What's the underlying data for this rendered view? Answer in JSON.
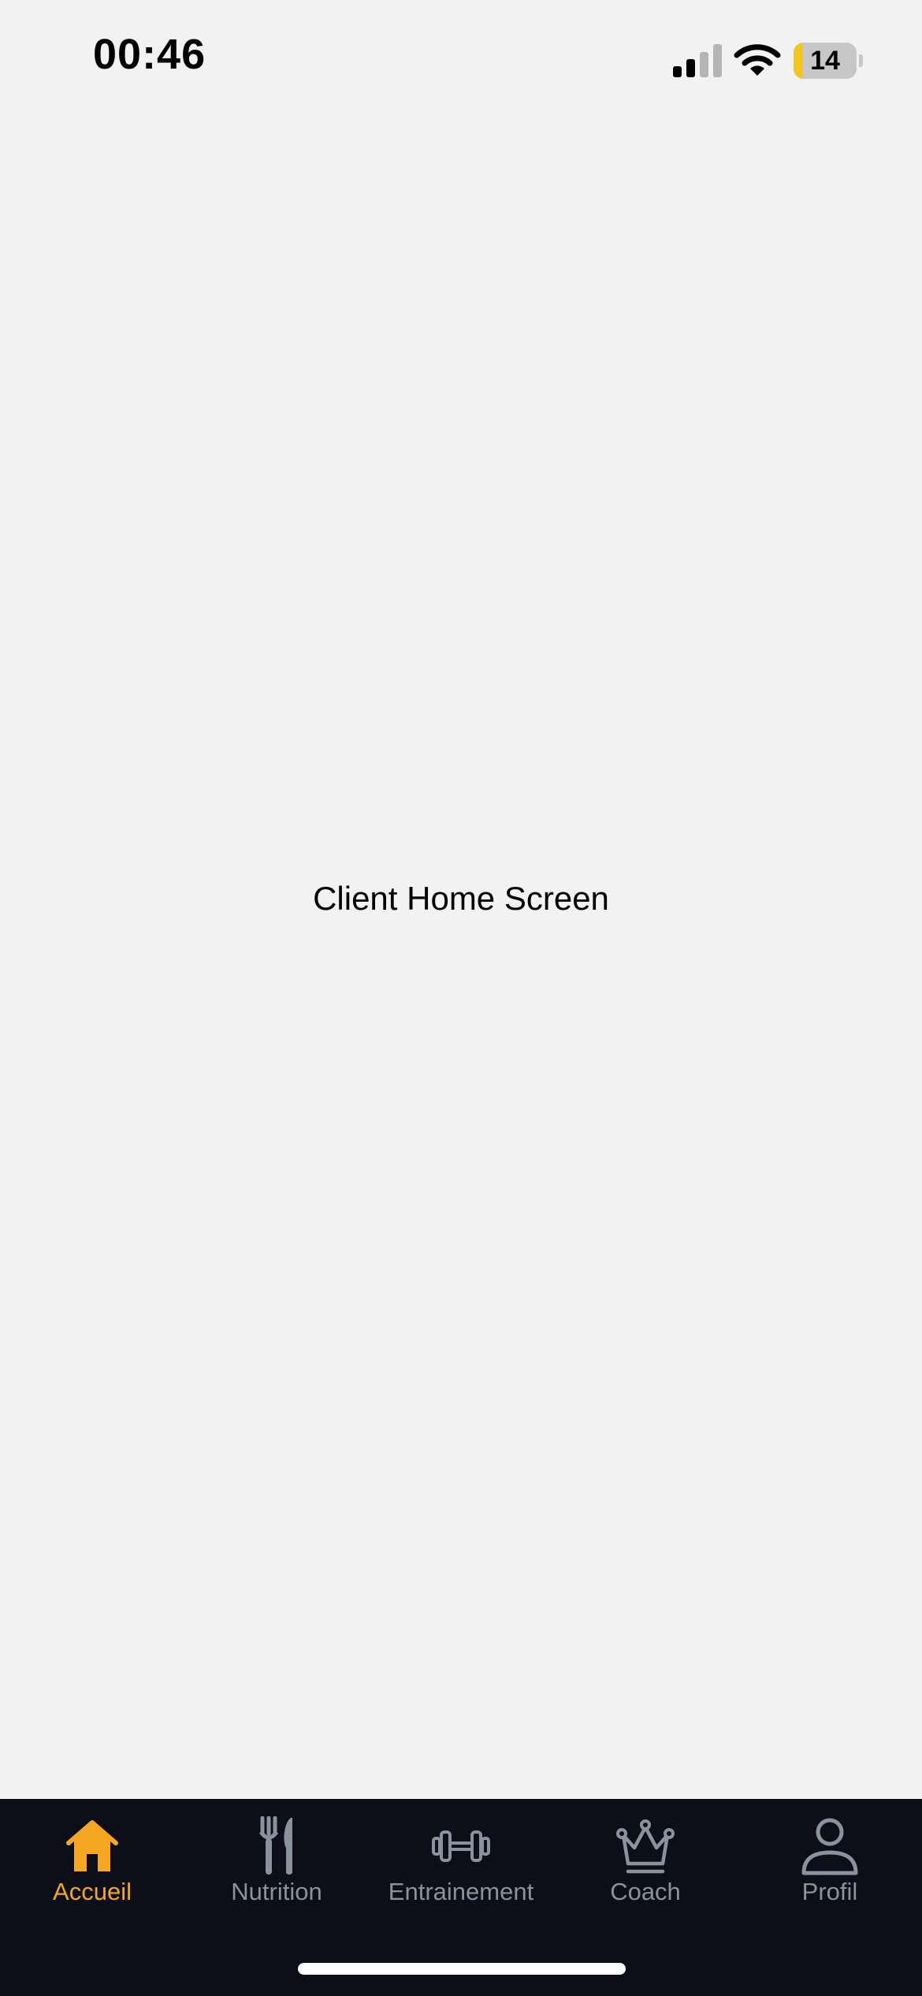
{
  "status_bar": {
    "time": "00:46",
    "battery_level": "14",
    "battery_fraction": 0.14,
    "signal_bars_active": 2,
    "signal_bars_total": 4
  },
  "main": {
    "label": "Client Home Screen"
  },
  "tab_bar": {
    "active_tab": "Accueil",
    "active_color": "#f5a623",
    "inactive_color": "#8a929c",
    "tabs": [
      {
        "label": "Accueil",
        "icon": "home-icon"
      },
      {
        "label": "Nutrition",
        "icon": "fork-knife-icon"
      },
      {
        "label": "Entrainement",
        "icon": "dumbbell-icon"
      },
      {
        "label": "Coach",
        "icon": "crown-icon"
      },
      {
        "label": "Profil",
        "icon": "person-icon"
      }
    ]
  }
}
